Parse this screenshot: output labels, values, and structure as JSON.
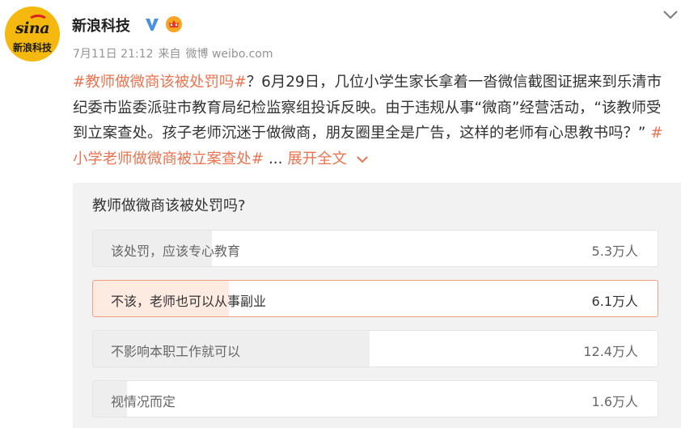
{
  "account": {
    "logo_text_en": "sina",
    "logo_text_cn": "新浪科技",
    "name": "新浪科技"
  },
  "meta": {
    "time": "7月11日 21:12",
    "from_label": "来自",
    "source": "微博 weibo.com"
  },
  "post": {
    "tag1": "#教师做微商该被处罚吗#",
    "text": "？6月29日，几位小学生家长拿着一沓微信截图证据来到乐清市纪委市监委派驻市教育局纪检监察组投诉反映。由于违规从事“微商”经营活动，“该教师受到立案查处。孩子老师沉迷于做微商，朋友圈里全是广告，这样的老师有心思教书吗？” ",
    "tag2": "#小学老师做微商被立案查处#",
    "ellipsis": " ... ",
    "expand_label": "展开全文"
  },
  "poll": {
    "question": "教师做微商该被处罚吗?",
    "options": [
      {
        "label": "该处罚，应该专心教育",
        "count": "5.3万人",
        "share": 0.21,
        "selected": false
      },
      {
        "label": "不该，老师也可以从事副业",
        "count": "6.1万人",
        "share": 0.24,
        "selected": true
      },
      {
        "label": "不影响本职工作就可以",
        "count": "12.4万人",
        "share": 0.49,
        "selected": false
      },
      {
        "label": "视情况而定",
        "count": "1.6万人",
        "share": 0.06,
        "selected": false
      }
    ]
  },
  "colors": {
    "accent": "#eb7350",
    "logo_bg": "#f5b80e",
    "verified": "#4a90e2",
    "poll_bg": "#f2f2f2"
  },
  "icons": {
    "verified": "verified-icon",
    "crown": "vip-crown-icon",
    "menu": "chevron-down-icon",
    "expand": "chevron-down-icon"
  }
}
